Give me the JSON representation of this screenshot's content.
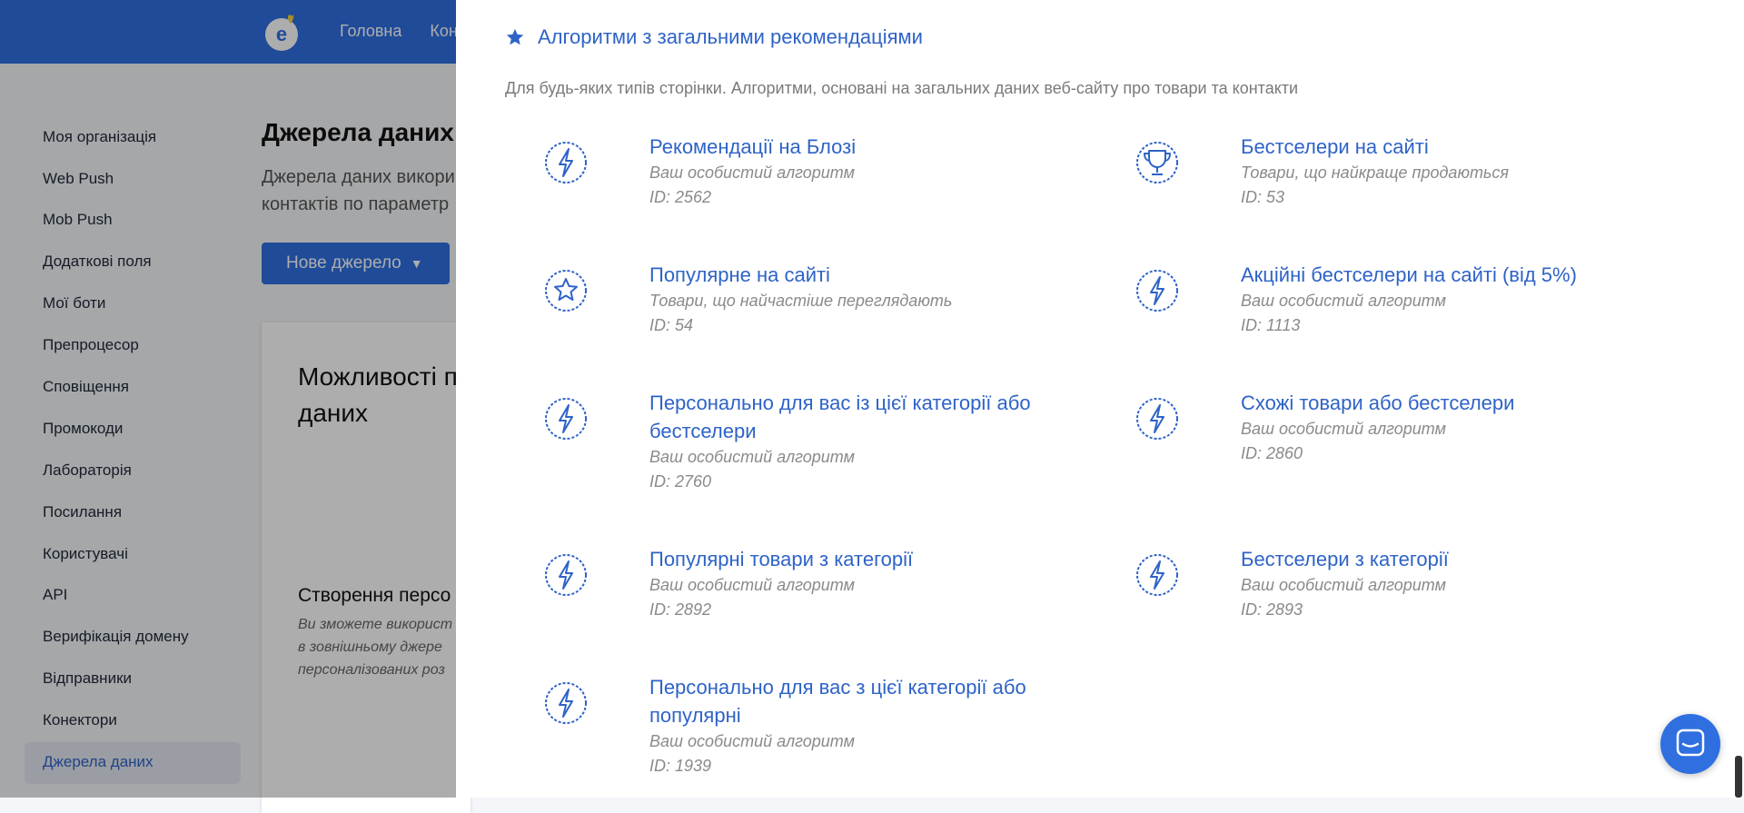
{
  "topnav": {
    "items": [
      "Головна",
      "Конт"
    ]
  },
  "sidebar": {
    "items": [
      {
        "label": "Моя організація"
      },
      {
        "label": "Web Push"
      },
      {
        "label": "Mob Push"
      },
      {
        "label": "Додаткові поля"
      },
      {
        "label": "Мої боти"
      },
      {
        "label": "Препроцесор"
      },
      {
        "label": "Сповіщення"
      },
      {
        "label": "Промокоди"
      },
      {
        "label": "Лабораторія"
      },
      {
        "label": "Посилання"
      },
      {
        "label": "Користувачі"
      },
      {
        "label": "API"
      },
      {
        "label": "Верифікація домену"
      },
      {
        "label": "Відправники"
      },
      {
        "label": "Конектори"
      },
      {
        "label": "Джерела даних"
      }
    ],
    "active": "Джерела даних"
  },
  "main": {
    "title": "Джерела даних",
    "desc_line1": "Джерела даних викори",
    "desc_line2": "контактів по параметр",
    "new_source_label": "Нове джерело",
    "card_title_1": "Можливості п",
    "card_title_2": "даних",
    "card_sub": "Створення персо",
    "card_text_1": "Ви зможете використ",
    "card_text_2": "в зовнішньому джере",
    "card_text_3": "персоналізованих роз"
  },
  "panel": {
    "section_title": "Алгоритми з загальними рекомендаціями",
    "section_desc": "Для будь-яких типів сторінки. Алгоритми, основані на загальних даних веб-сайту про товари та контакти",
    "algorithms": [
      {
        "title": "Рекомендації на Блозі",
        "subtitle": "Ваш особистий алгоритм",
        "id": "ID: 2562",
        "icon": "lightning-badge-icon"
      },
      {
        "title": "Бестселери на сайті",
        "subtitle": "Товари, що найкраще продаються",
        "id": "ID: 53",
        "icon": "trophy-badge-icon"
      },
      {
        "title": "Популярне на сайті",
        "subtitle": "Товари, що найчастіше переглядають",
        "id": "ID: 54",
        "icon": "star-badge-icon"
      },
      {
        "title": "Акційні бестселери на сайті (від 5%)",
        "subtitle": "Ваш особистий алгоритм",
        "id": "ID: 1113",
        "icon": "lightning-badge-icon"
      },
      {
        "title": "Персонально для вас із цієї категорії або бестселери",
        "subtitle": "Ваш особистий алгоритм",
        "id": "ID: 2760",
        "icon": "lightning-badge-icon"
      },
      {
        "title": "Схожі товари або бестселери",
        "subtitle": "Ваш особистий алгоритм",
        "id": "ID: 2860",
        "icon": "lightning-badge-icon"
      },
      {
        "title": "Популярні товари з категорії",
        "subtitle": "Ваш особистий алгоритм",
        "id": "ID: 2892",
        "icon": "lightning-badge-icon"
      },
      {
        "title": "Бестселери з категорії",
        "subtitle": "Ваш особистий алгоритм",
        "id": "ID: 2893",
        "icon": "lightning-badge-icon"
      },
      {
        "title": "Персонально для вас з цієї категорії або популярні",
        "subtitle": "Ваш особистий алгоритм",
        "id": "ID: 1939",
        "icon": "lightning-badge-icon"
      }
    ]
  },
  "colors": {
    "accent": "#2e63c7",
    "brand": "#2f6fe0",
    "muted": "#8a8a8a"
  }
}
